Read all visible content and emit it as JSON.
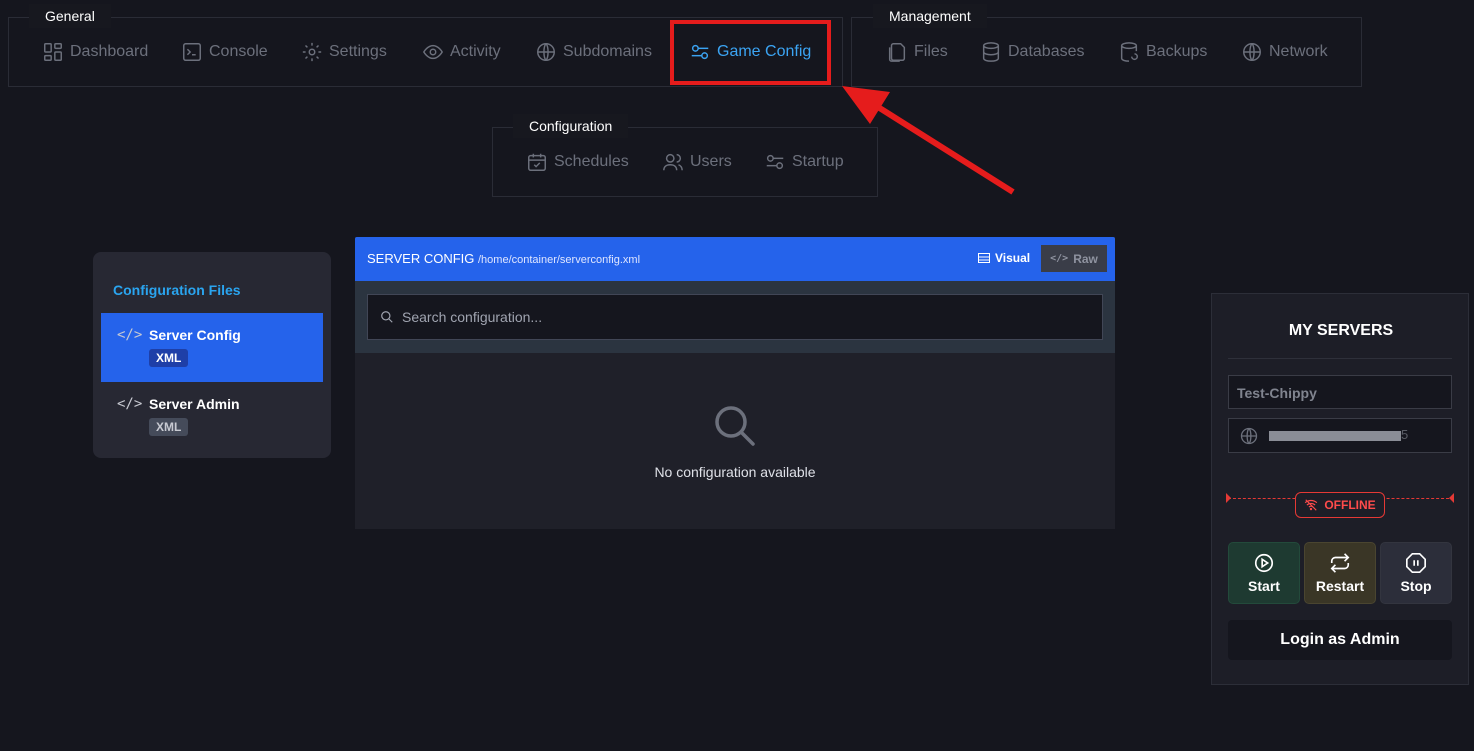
{
  "nav": {
    "general": {
      "title": "General",
      "items": [
        {
          "label": "Dashboard",
          "icon": "dashboard-icon"
        },
        {
          "label": "Console",
          "icon": "terminal-icon"
        },
        {
          "label": "Settings",
          "icon": "gear-icon"
        },
        {
          "label": "Activity",
          "icon": "eye-icon"
        },
        {
          "label": "Subdomains",
          "icon": "globe-icon"
        },
        {
          "label": "Game Config",
          "icon": "sliders-icon",
          "active": true
        }
      ]
    },
    "management": {
      "title": "Management",
      "items": [
        {
          "label": "Files",
          "icon": "files-icon"
        },
        {
          "label": "Databases",
          "icon": "database-icon"
        },
        {
          "label": "Backups",
          "icon": "backup-icon"
        },
        {
          "label": "Network",
          "icon": "globe-icon"
        }
      ]
    },
    "configuration": {
      "title": "Configuration",
      "items": [
        {
          "label": "Schedules",
          "icon": "calendar-icon"
        },
        {
          "label": "Users",
          "icon": "users-icon"
        },
        {
          "label": "Startup",
          "icon": "sliders-icon"
        }
      ]
    }
  },
  "config_files": {
    "title": "Configuration Files",
    "items": [
      {
        "label": "Server Config",
        "badge": "XML",
        "active": true
      },
      {
        "label": "Server Admin",
        "badge": "XML",
        "active": false
      }
    ]
  },
  "editor": {
    "title": "SERVER CONFIG",
    "path": "/home/container/serverconfig.xml",
    "visual_label": "Visual",
    "raw_label": "Raw",
    "search_placeholder": "Search configuration...",
    "empty_text": "No configuration available"
  },
  "servers": {
    "title": "MY SERVERS",
    "server_name": "Test-Chippy",
    "address_tail": "5",
    "status": "OFFLINE",
    "start_label": "Start",
    "restart_label": "Restart",
    "stop_label": "Stop",
    "admin_label": "Login as Admin"
  },
  "colors": {
    "accent": "#2563eb",
    "active_link": "#3ba4f3",
    "offline": "#ff4b4b",
    "highlight": "#e51c1c"
  }
}
